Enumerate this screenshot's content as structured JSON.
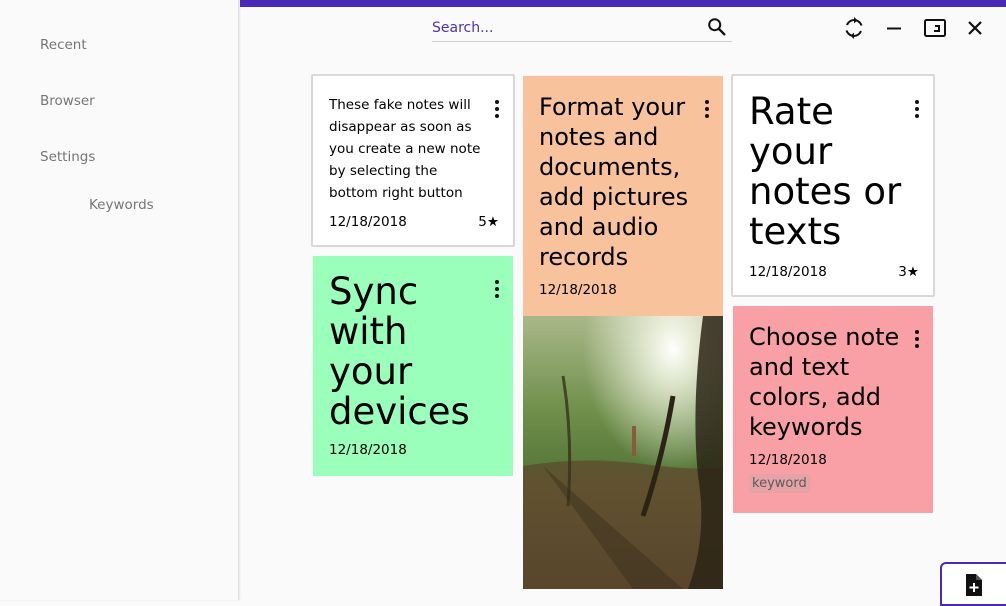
{
  "sidebar": {
    "items": [
      {
        "label": "Recent"
      },
      {
        "label": "Browser"
      },
      {
        "label": "Settings"
      }
    ],
    "sub_items": [
      {
        "label": "Keywords"
      }
    ]
  },
  "search": {
    "placeholder": "Search..."
  },
  "window_controls": [
    "sync-icon",
    "minimize-icon",
    "restore-icon",
    "close-icon"
  ],
  "colors": {
    "accent": "#4a2bb8",
    "note_green": "#99ffbb",
    "note_peach": "#f8c29c",
    "note_pink": "#f9a0a6",
    "note_white": "#ffffff"
  },
  "notes": [
    {
      "text": "These fake notes will disappear as soon as you create a new note by selecting the bottom right button",
      "date": "12/18/2018",
      "rating": "5★"
    },
    {
      "text": "Sync with your devices",
      "date": "12/18/2018"
    },
    {
      "text": "Format your notes and documents, add pictures and audio records",
      "date": "12/18/2018"
    },
    {
      "text": "Rate your notes or texts",
      "date": "12/18/2018",
      "rating": "3★"
    },
    {
      "text": "Choose note and text colors, add keywords",
      "date": "12/18/2018",
      "keyword": "keyword"
    }
  ],
  "fab": {
    "icon": "add-note-icon"
  }
}
